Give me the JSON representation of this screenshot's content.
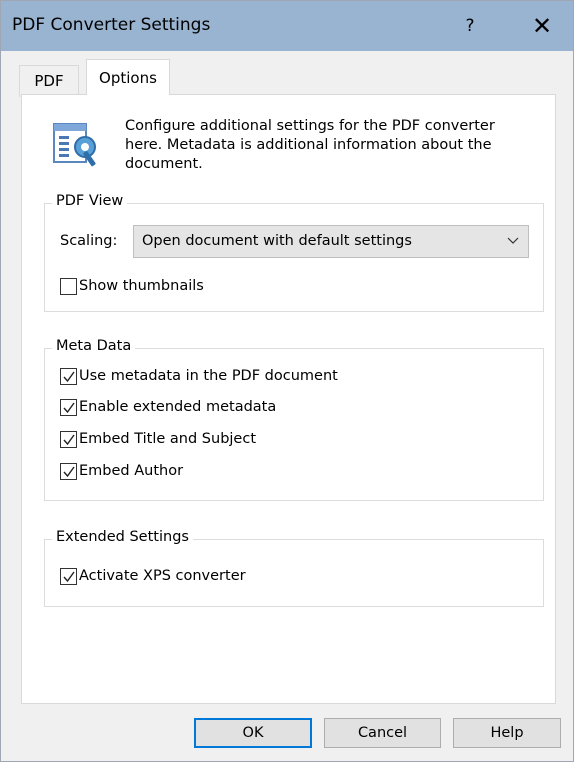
{
  "window": {
    "title": "PDF Converter Settings",
    "help_glyph": "?",
    "close_glyph": "✕"
  },
  "tabs": [
    {
      "label": "PDF",
      "selected": false
    },
    {
      "label": "Options",
      "selected": true
    }
  ],
  "intro": {
    "icon": "settings-document-icon",
    "text": "Configure additional settings for the PDF converter here. Metadata is additional information about the document."
  },
  "pdf_view": {
    "title": "PDF View",
    "scaling_label": "Scaling:",
    "scaling_value": "Open document with default settings",
    "show_thumbnails": {
      "label": "Show thumbnails",
      "checked": false
    }
  },
  "meta_data": {
    "title": "Meta Data",
    "options": [
      {
        "label": "Use metadata in the PDF document",
        "checked": true
      },
      {
        "label": "Enable extended metadata",
        "checked": true
      },
      {
        "label": "Embed Title and Subject",
        "checked": true
      },
      {
        "label": "Embed Author",
        "checked": true
      }
    ]
  },
  "extended_settings": {
    "title": "Extended Settings",
    "activate_xps": {
      "label": "Activate XPS converter",
      "checked": true
    }
  },
  "buttons": {
    "ok": "OK",
    "cancel": "Cancel",
    "help": "Help"
  },
  "colors": {
    "titlebar": "#99b4d1",
    "focus_border": "#0078d7"
  }
}
